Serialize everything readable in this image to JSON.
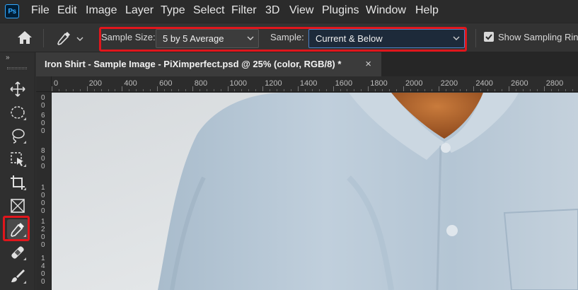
{
  "app": {
    "logo_text": "Ps"
  },
  "menu": [
    "File",
    "Edit",
    "Image",
    "Layer",
    "Type",
    "Select",
    "Filter",
    "3D",
    "View",
    "Plugins",
    "Window",
    "Help"
  ],
  "options_bar": {
    "sample_size_label": "Sample Size:",
    "sample_size_value": "5 by 5 Average",
    "sample_label": "Sample:",
    "sample_value": "Current & Below",
    "show_ring_label": "Show Sampling Ring",
    "show_ring_checked": true
  },
  "toolbar": {
    "collapse": "»",
    "tools": [
      "move-tool",
      "marquee-tool",
      "lasso-tool",
      "object-selection-tool",
      "crop-tool",
      "frame-tool",
      "eyedropper-tool",
      "healing-brush-tool",
      "brush-tool"
    ],
    "selected_tool": "eyedropper-tool"
  },
  "document": {
    "tab_title": "Iron Shirt - Sample Image - PiXimperfect.psd @ 25% (color, RGB/8) *",
    "close_glyph": "×"
  },
  "ruler": {
    "horizontal_labels": [
      "0",
      "200",
      "400",
      "600",
      "800",
      "1000",
      "1200",
      "1400",
      "1600",
      "1800",
      "2000",
      "2200",
      "2400",
      "2600",
      "2800"
    ],
    "vertical_labels": [
      "4",
      "0",
      "0",
      "6",
      "0",
      "0",
      "8",
      "0",
      "0",
      "1",
      "0",
      "0",
      "0",
      "1",
      "2",
      "0",
      "0",
      "1",
      "4",
      "0",
      "0"
    ]
  },
  "colors": {
    "highlight": "#e0161c",
    "accent": "#31a8ff",
    "shirt": "#b9c9d7",
    "skin": "#b5672e"
  }
}
